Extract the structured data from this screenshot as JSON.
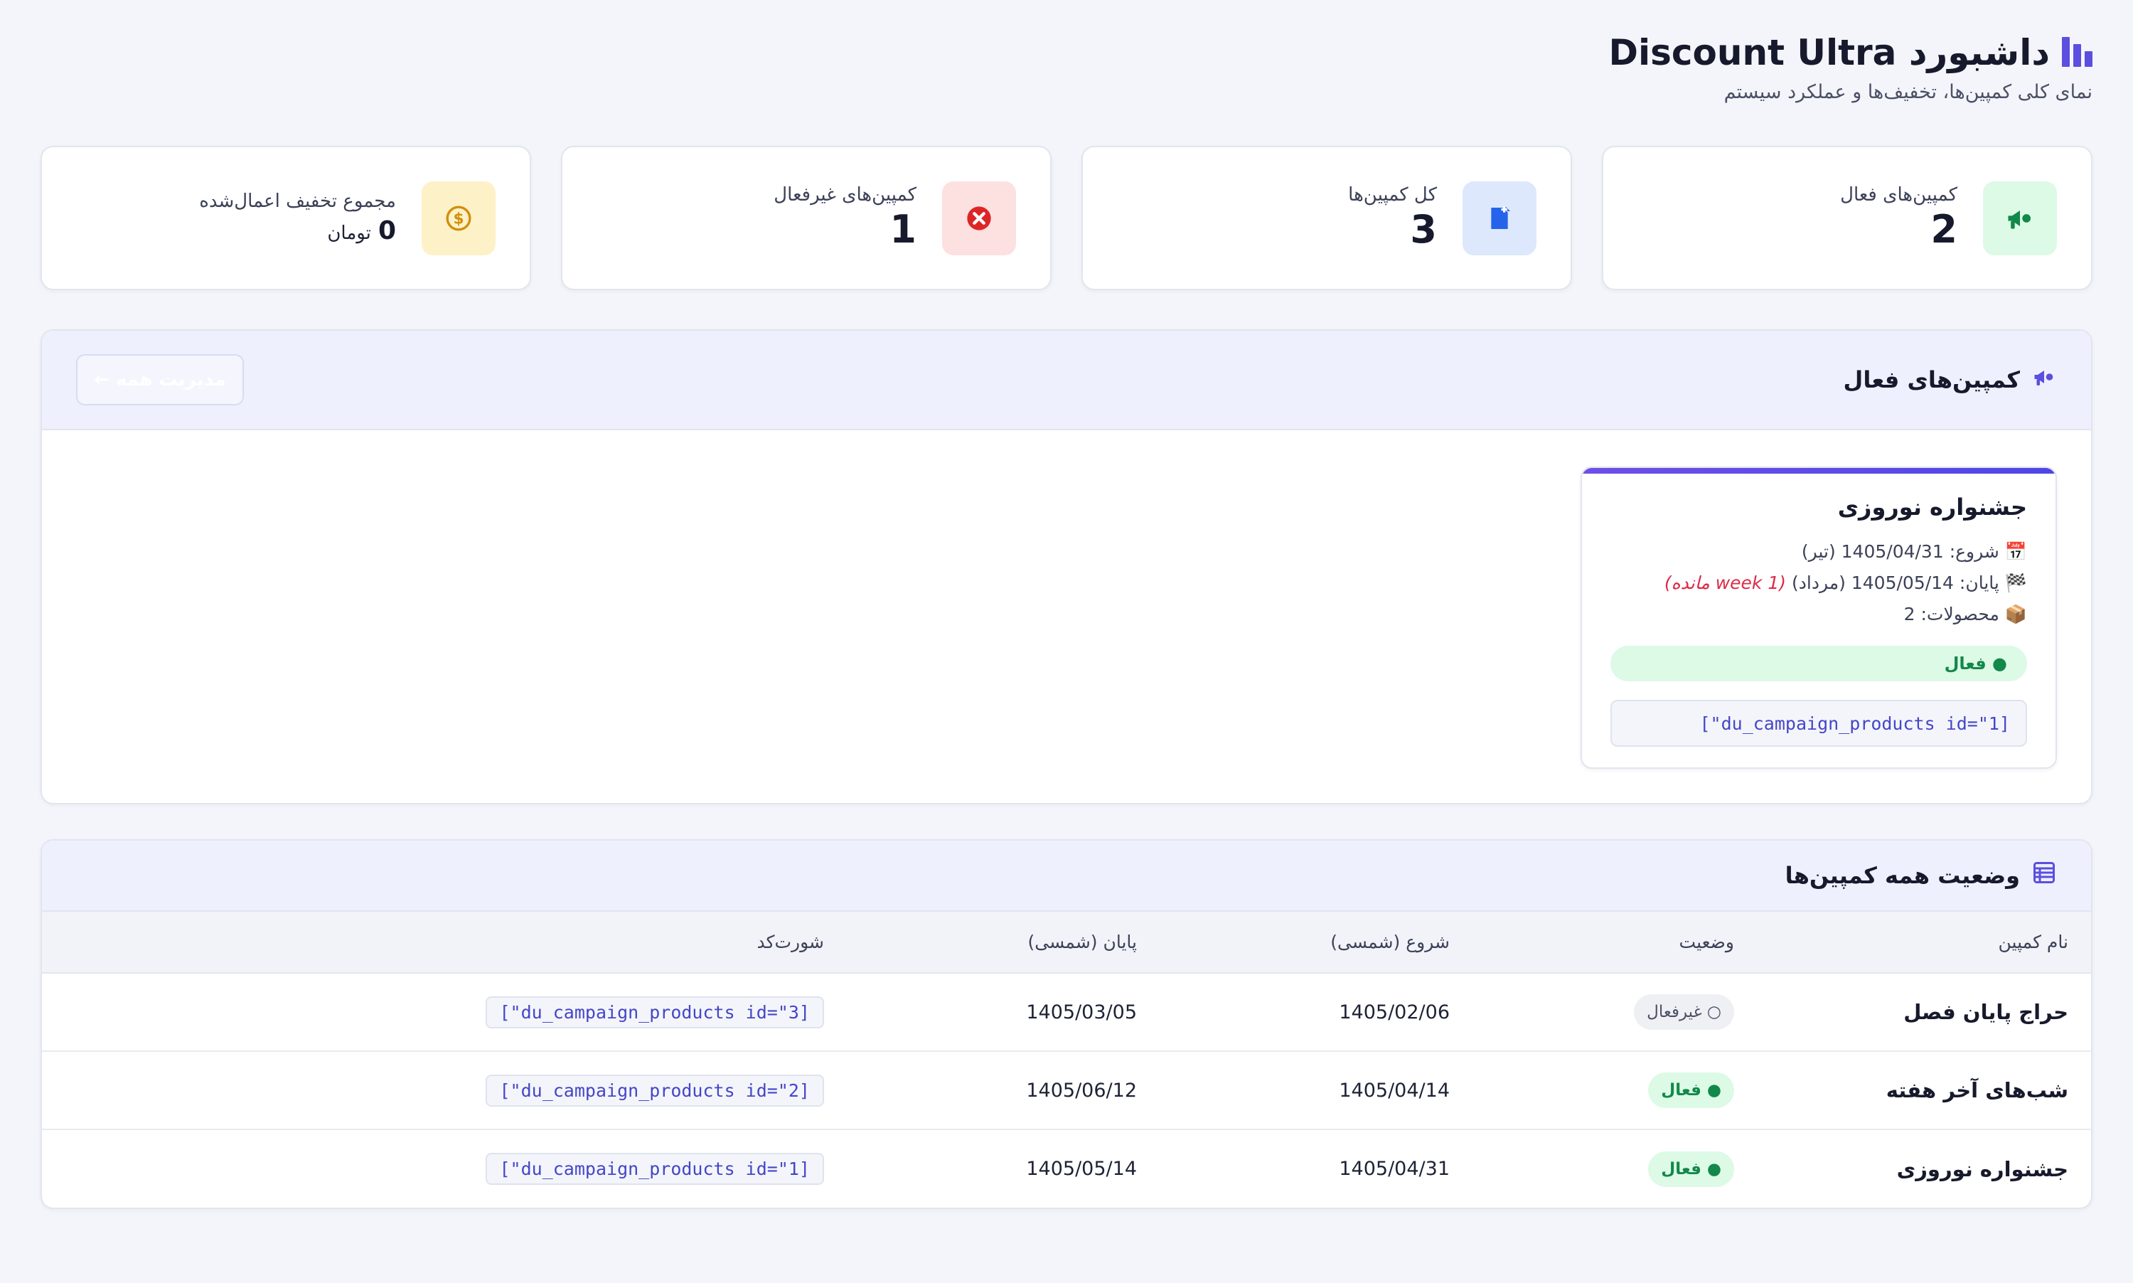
{
  "header": {
    "title": "داشبورد Discount Ultra",
    "subtitle": "نمای کلی کمپین‌ها، تخفیف‌ها و عملکرد سیستم"
  },
  "stats": [
    {
      "label": "کمپین‌های فعال",
      "value": "2",
      "icon": "megaphone-icon",
      "color": "#dcfae6"
    },
    {
      "label": "کل کمپین‌ها",
      "value": "3",
      "icon": "document-icon",
      "color": "#dde8fd"
    },
    {
      "label": "کمپین‌های غیرفعال",
      "value": "1",
      "icon": "close-circle-icon",
      "color": "#fde0e0"
    },
    {
      "label": "مجموع تخفیف اعمال‌شده",
      "value": "0",
      "unit": "تومان",
      "icon": "dollar-coin-icon",
      "color": "#fdf1c8"
    }
  ],
  "active_section": {
    "title": "کمپین‌های فعال",
    "manage_button": "مدیریت همه ←",
    "card": {
      "name": "جشنواره نوروزی",
      "start": "شروع: 1405/04/31 (تیر)",
      "end": "پایان: 1405/05/14 (مرداد)",
      "remaining": "(1 week مانده)",
      "products": "محصولات: 2",
      "status": "● فعال",
      "shortcode": "[\"du_campaign_products id=\"1]"
    }
  },
  "table_section": {
    "title": "وضعیت همه کمپین‌ها",
    "columns": [
      "نام کمپین",
      "وضعیت",
      "شروع (شمسی)",
      "پایان (شمسی)",
      "شورت‌کد"
    ],
    "rows": [
      {
        "name": "حراج پایان فصل",
        "status": "○ غیرفعال",
        "status_type": "inactive",
        "start": "1405/02/06",
        "end": "1405/03/05",
        "shortcode": "[\"du_campaign_products id=\"3]"
      },
      {
        "name": "شب‌های آخر هفته",
        "status": "● فعال",
        "status_type": "active",
        "start": "1405/04/14",
        "end": "1405/06/12",
        "shortcode": "[\"du_campaign_products id=\"2]"
      },
      {
        "name": "جشنواره نوروزی",
        "status": "● فعال",
        "status_type": "active",
        "start": "1405/04/31",
        "end": "1405/05/14",
        "shortcode": "[\"du_campaign_products id=\"1]"
      }
    ]
  },
  "colors": {
    "accent": "#5b4fe0",
    "active_green": "#12884a",
    "danger_red": "#dc2b48"
  }
}
